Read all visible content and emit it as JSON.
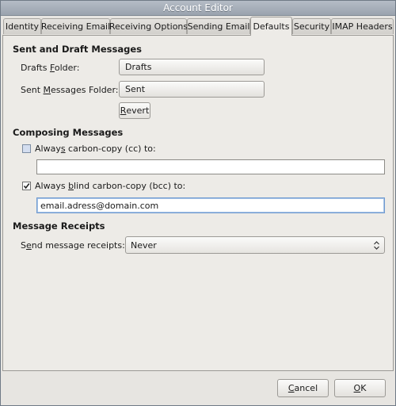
{
  "window": {
    "title": "Account Editor"
  },
  "tabs": [
    {
      "id": "identity",
      "label": "Identity",
      "active": false
    },
    {
      "id": "receiving-email",
      "label": "Receiving Email",
      "active": false
    },
    {
      "id": "receiving-options",
      "label": "Receiving Options",
      "active": false
    },
    {
      "id": "sending-email",
      "label": "Sending Email",
      "active": false
    },
    {
      "id": "defaults",
      "label": "Defaults",
      "active": true
    },
    {
      "id": "security",
      "label": "Security",
      "active": false
    },
    {
      "id": "imap-headers",
      "label": "IMAP Headers",
      "active": false
    }
  ],
  "sent_drafts": {
    "title": "Sent and Draft Messages",
    "drafts_label": {
      "pre": "Drafts ",
      "u": "F",
      "post": "older:"
    },
    "drafts_value": "Drafts",
    "sent_label": {
      "pre": "Sent ",
      "u": "M",
      "post": "essages Folder:"
    },
    "sent_value": "Sent",
    "revert": {
      "pre": "",
      "u": "R",
      "post": "evert"
    }
  },
  "composing": {
    "title": "Composing Messages",
    "cc_label": {
      "pre": "Alway",
      "u": "s",
      "post": " carbon-copy (cc) to:"
    },
    "cc_checked": false,
    "cc_value": "",
    "bcc_label": {
      "pre": "Always ",
      "u": "b",
      "post": "lind carbon-copy (bcc) to:"
    },
    "bcc_checked": true,
    "bcc_value": "email.adress@domain.com"
  },
  "receipts": {
    "title": "Message Receipts",
    "label": {
      "pre": "S",
      "u": "e",
      "post": "nd message receipts:"
    },
    "value": "Never"
  },
  "footer": {
    "cancel": {
      "pre": "",
      "u": "C",
      "post": "ancel"
    },
    "ok": {
      "pre": "",
      "u": "O",
      "post": "K"
    }
  }
}
